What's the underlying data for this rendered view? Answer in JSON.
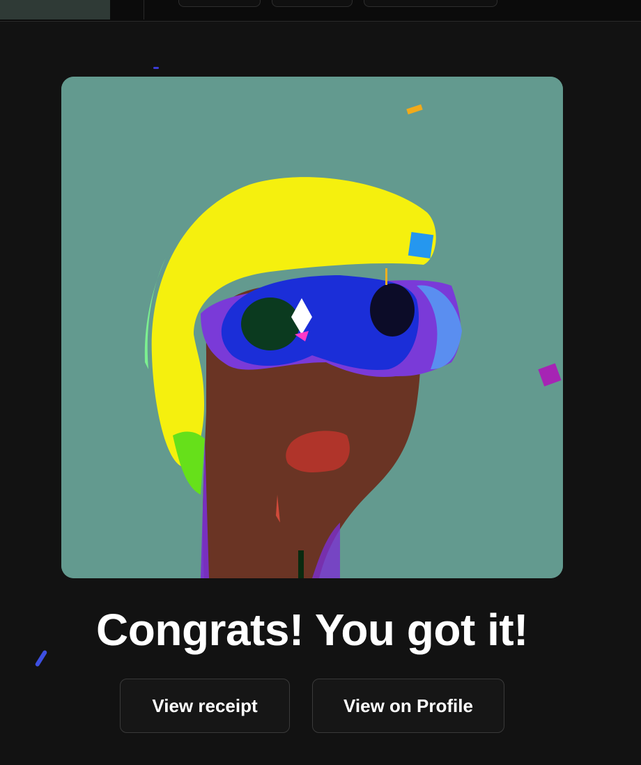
{
  "celebration": {
    "heading": "Congrats! You got it!",
    "artwork_description_icon": "nft-artwork-image"
  },
  "actions": {
    "view_receipt_label": "View receipt",
    "view_profile_label": "View on Profile"
  },
  "colors": {
    "background": "#121212",
    "artwork_background": "#639a8f",
    "button_background": "#161616",
    "button_border": "#3a3a3a",
    "text": "#ffffff"
  }
}
